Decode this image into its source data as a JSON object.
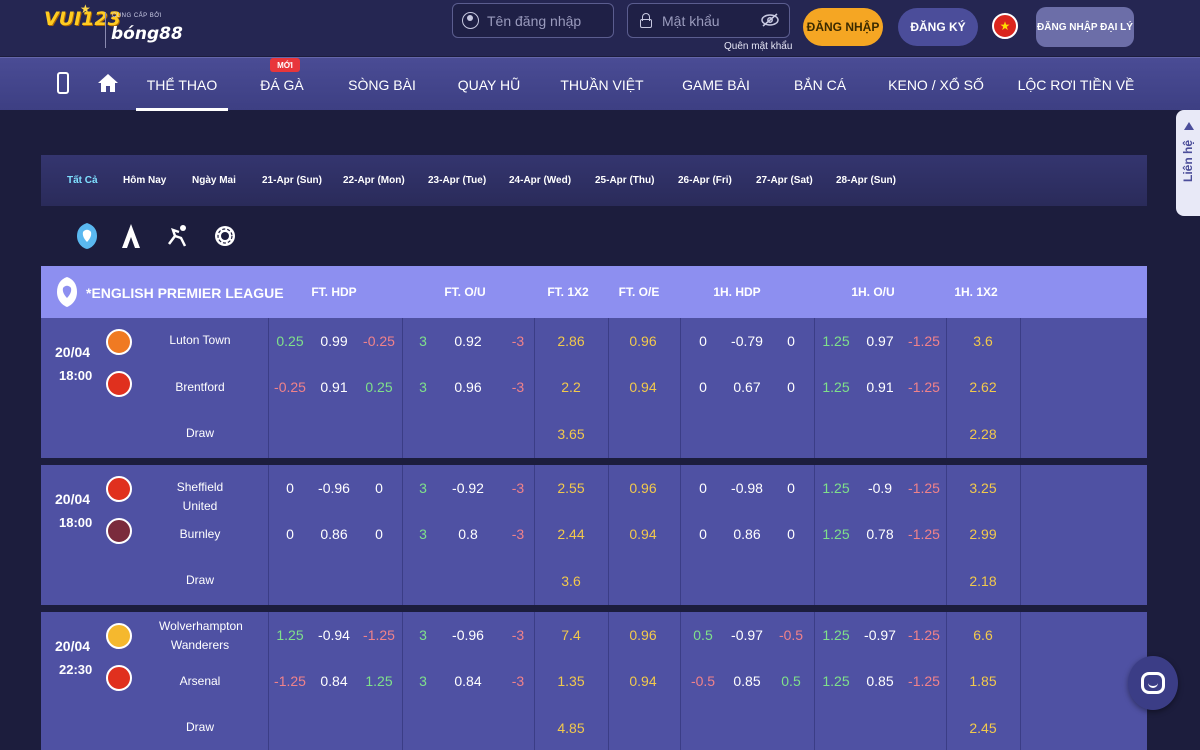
{
  "header": {
    "logo_text": "VUI123",
    "logo_sub": "CUNG CẤP BỞI",
    "logo_brand": "bóng88",
    "username_placeholder": "Tên đăng nhập",
    "password_placeholder": "Mật khẩu",
    "forgot_password": "Quên mật khẩu",
    "login_button": "ĐĂNG NHẬP",
    "register_button": "ĐĂNG KÝ",
    "agent_login_button": "ĐĂNG NHẬP ĐẠI LÝ",
    "flag_icon": "vietnam-flag-icon"
  },
  "nav": {
    "items": [
      {
        "label": "THỂ THAO",
        "active": true
      },
      {
        "label": "ĐÁ GÀ",
        "badge": "MỚI"
      },
      {
        "label": "SÒNG BÀI"
      },
      {
        "label": "QUAY HŨ"
      },
      {
        "label": "THUẦN VIỆT"
      },
      {
        "label": "GAME BÀI"
      },
      {
        "label": "BẮN CÁ"
      },
      {
        "label": "KENO / XỔ SỐ"
      },
      {
        "label": "LỘC RƠI TIỀN VỀ"
      }
    ]
  },
  "side_tab": {
    "label": "Liên hệ"
  },
  "dates": [
    "Tất Cả",
    "Hôm Nay",
    "Ngày Mai",
    "21-Apr (Sun)",
    "22-Apr (Mon)",
    "23-Apr (Tue)",
    "24-Apr (Wed)",
    "25-Apr (Thu)",
    "26-Apr (Fri)",
    "27-Apr (Sat)",
    "28-Apr (Sun)"
  ],
  "league": {
    "name": "*ENGLISH PREMIER LEAGUE",
    "columns": [
      "FT. HDP",
      "FT. O/U",
      "FT. 1X2",
      "FT. O/E",
      "1H. HDP",
      "1H. O/U",
      "1H. 1X2"
    ]
  },
  "matches": [
    {
      "date": "20/04",
      "time": "18:00",
      "home": "Luton Town",
      "away": "Brentford",
      "draw": "Draw",
      "home_row": [
        "0.25",
        "0.99",
        "-0.25",
        "3",
        "0.92",
        "-3",
        "2.86",
        "0.96",
        "0",
        "-0.79",
        "0",
        "1.25",
        "0.97",
        "-1.25",
        "3.6"
      ],
      "away_row": [
        "-0.25",
        "0.91",
        "0.25",
        "3",
        "0.96",
        "-3",
        "2.2",
        "0.94",
        "0",
        "0.67",
        "0",
        "1.25",
        "0.91",
        "-1.25",
        "2.62"
      ],
      "draw_row": [
        "3.65",
        "2.28"
      ]
    },
    {
      "date": "20/04",
      "time": "18:00",
      "home": "Sheffield United",
      "away": "Burnley",
      "draw": "Draw",
      "home_row": [
        "0",
        "-0.96",
        "0",
        "3",
        "-0.92",
        "-3",
        "2.55",
        "0.96",
        "0",
        "-0.98",
        "0",
        "1.25",
        "-0.9",
        "-1.25",
        "3.25"
      ],
      "away_row": [
        "0",
        "0.86",
        "0",
        "3",
        "0.8",
        "-3",
        "2.44",
        "0.94",
        "0",
        "0.86",
        "0",
        "1.25",
        "0.78",
        "-1.25",
        "2.99"
      ],
      "draw_row": [
        "3.6",
        "2.18"
      ]
    },
    {
      "date": "20/04",
      "time": "22:30",
      "home": "Wolverhampton Wanderers",
      "away": "Arsenal",
      "draw": "Draw",
      "home_row": [
        "1.25",
        "-0.94",
        "-1.25",
        "3",
        "-0.96",
        "-3",
        "7.4",
        "0.96",
        "0.5",
        "-0.97",
        "-0.5",
        "1.25",
        "-0.97",
        "-1.25",
        "6.6"
      ],
      "away_row": [
        "-1.25",
        "0.84",
        "1.25",
        "3",
        "0.84",
        "-3",
        "1.35",
        "0.94",
        "-0.5",
        "0.85",
        "0.5",
        "1.25",
        "0.85",
        "-1.25",
        "1.85"
      ],
      "draw_row": [
        "4.85",
        "2.45"
      ]
    }
  ],
  "colors": {
    "positive": "#7fe08a",
    "negative": "#f0828a",
    "odds": "#f2c94c",
    "league_bar": "#8d8ff0",
    "match_bg": "#4f51a3"
  }
}
